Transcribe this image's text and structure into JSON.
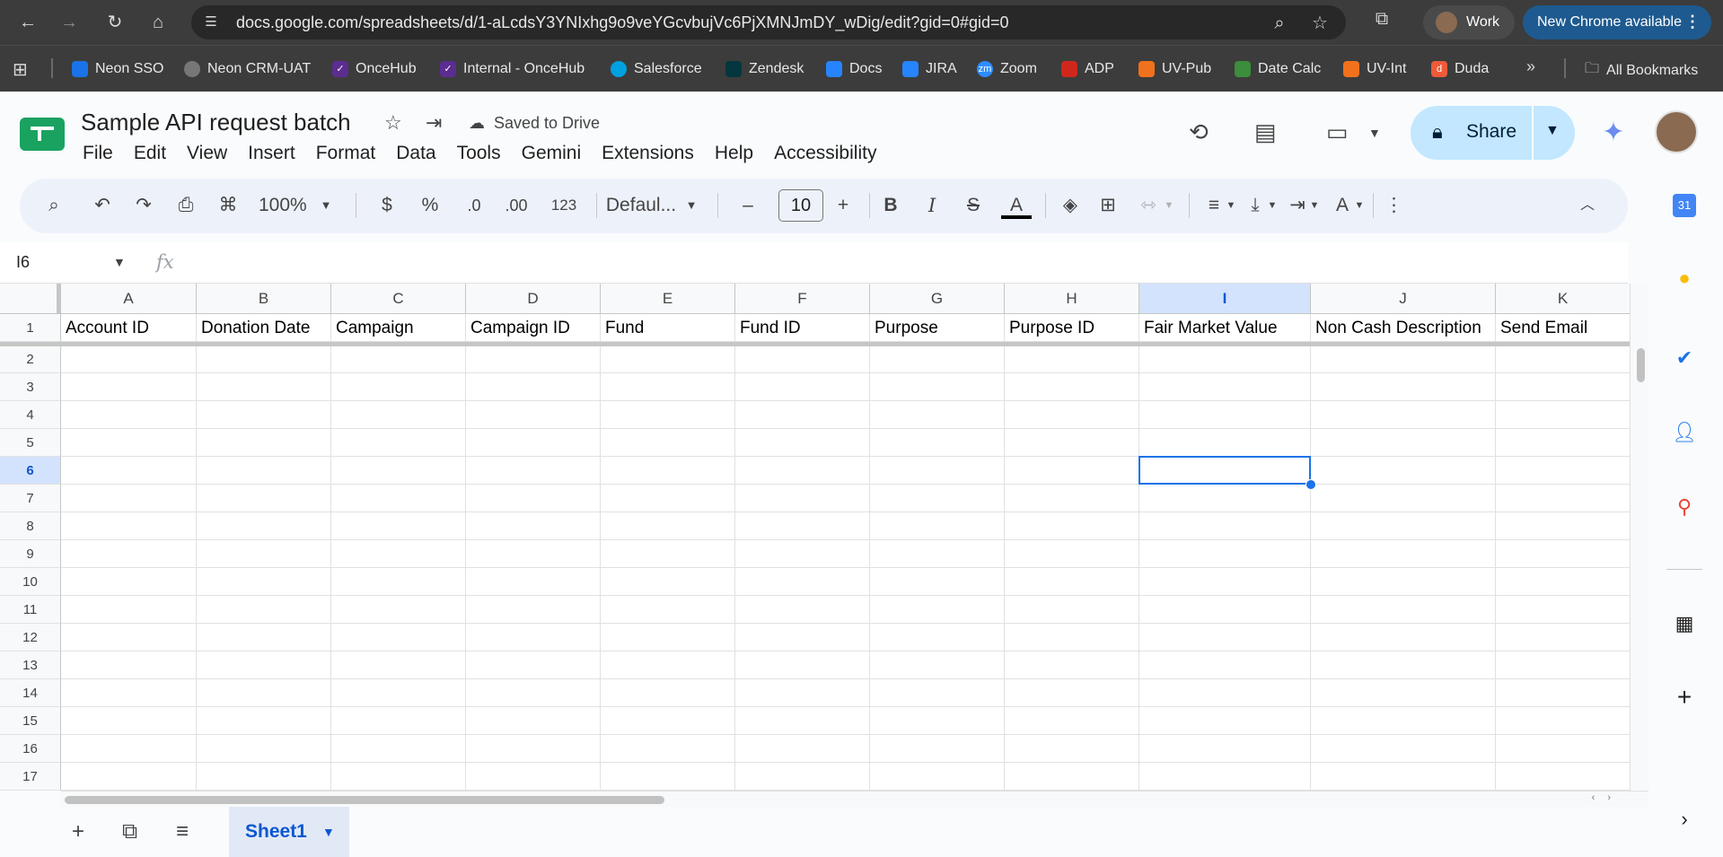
{
  "browser": {
    "url": "docs.google.com/spreadsheets/d/1-aLcdsY3YNIxhg9o9veYGcvbujVc6PjXMNJmDY_wDig/edit?gid=0#gid=0",
    "profile_label": "Work",
    "update_label": "New Chrome available",
    "bookmarks": [
      {
        "label": "Neon SSO",
        "color": "#1a73e8"
      },
      {
        "label": "Neon CRM-UAT",
        "color": "#777777"
      },
      {
        "label": "OnceHub",
        "color": "#5b2d90"
      },
      {
        "label": "Internal - OnceHub",
        "color": "#5b2d90"
      },
      {
        "label": "Salesforce",
        "color": "#00a1e0"
      },
      {
        "label": "Zendesk",
        "color": "#03363d"
      },
      {
        "label": "Docs",
        "color": "#2684ff"
      },
      {
        "label": "JIRA",
        "color": "#2684ff"
      },
      {
        "label": "Zoom",
        "color": "#2d8cff"
      },
      {
        "label": "ADP",
        "color": "#d0271d"
      },
      {
        "label": "UV-Pub",
        "color": "#f2711c"
      },
      {
        "label": "Date Calc",
        "color": "#3c8d3c"
      },
      {
        "label": "UV-Int",
        "color": "#f2711c"
      },
      {
        "label": "Duda",
        "color": "#ef5a3a"
      }
    ],
    "all_bookmarks_label": "All Bookmarks"
  },
  "doc": {
    "title": "Sample API request batch",
    "saved_label": "Saved to Drive",
    "menu": [
      "File",
      "Edit",
      "View",
      "Insert",
      "Format",
      "Data",
      "Tools",
      "Gemini",
      "Extensions",
      "Help",
      "Accessibility"
    ],
    "share_label": "Share"
  },
  "toolbar": {
    "zoom": "100%",
    "currency": "$",
    "percent": "%",
    "dec_less": ".0",
    "dec_more": ".00",
    "number_format": "123",
    "font": "Defaul...",
    "font_size": "10",
    "minus": "–",
    "plus": "+",
    "bold": "B",
    "italic": "I",
    "strike": "S",
    "text_color": "A",
    "text_color_value": "#000000"
  },
  "formula_bar": {
    "name_box": "I6",
    "fx": "fx",
    "value": ""
  },
  "grid": {
    "columns": [
      "A",
      "B",
      "C",
      "D",
      "E",
      "F",
      "G",
      "H",
      "I",
      "J",
      "K"
    ],
    "headers": [
      "Account ID",
      "Donation Date",
      "Campaign",
      "Campaign ID",
      "Fund",
      "Fund ID",
      "Purpose",
      "Purpose ID",
      "Fair Market Value",
      "Non Cash Description",
      "Send Email"
    ],
    "rows": [
      "1",
      "2",
      "3",
      "4",
      "5",
      "6",
      "7",
      "8",
      "9",
      "10",
      "11",
      "12",
      "13",
      "14",
      "15",
      "16",
      "17"
    ],
    "selected_cell": "I6",
    "selected_column": "I",
    "selected_row": "6"
  },
  "sheets": {
    "tabs": [
      "Sheet1"
    ],
    "active": "Sheet1"
  }
}
